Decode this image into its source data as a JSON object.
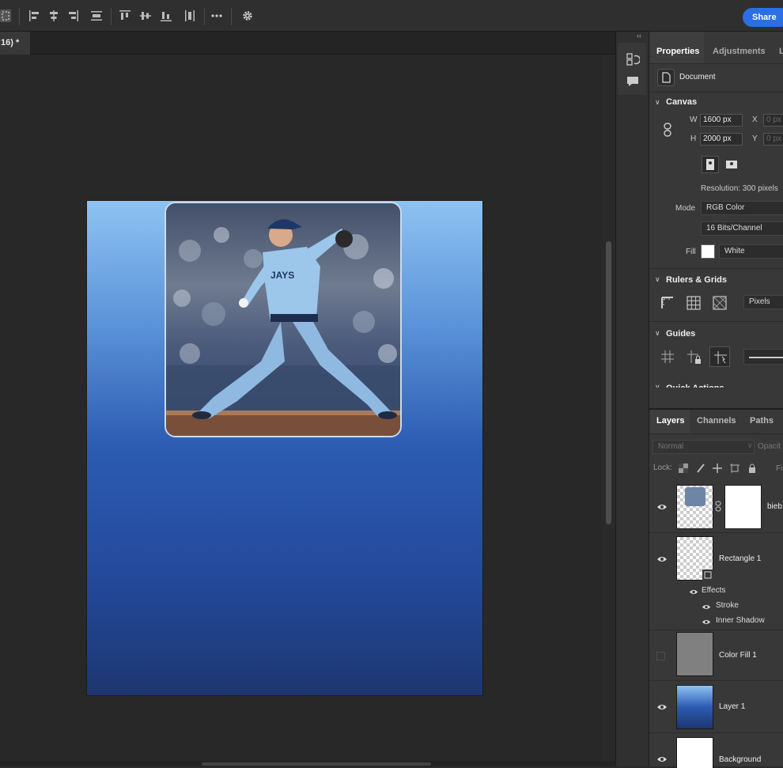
{
  "window": {
    "title_fragment": "..."
  },
  "toolbar": {
    "share_label": "Share"
  },
  "document": {
    "tab_label": "16) *"
  },
  "properties": {
    "tabs": [
      "Properties",
      "Adjustments",
      "L"
    ],
    "document_label": "Document",
    "canvas": {
      "title": "Canvas",
      "w_label": "W",
      "w_value": "1600 px",
      "h_label": "H",
      "h_value": "2000 px",
      "x_label": "X",
      "x_placeholder": "0 px",
      "y_label": "Y",
      "y_placeholder": "0 px",
      "resolution": "Resolution: 300 pixels",
      "mode_label": "Mode",
      "mode_value": "RGB Color",
      "bits_value": "16 Bits/Channel",
      "fill_label": "Fill",
      "fill_value": "White"
    },
    "rulers": {
      "title": "Rulers & Grids",
      "unit": "Pixels"
    },
    "guides": {
      "title": "Guides"
    },
    "quick_actions": {
      "title": "Quick Actions"
    }
  },
  "layers_panel": {
    "tabs": [
      "Layers",
      "Channels",
      "Paths"
    ],
    "blend_mode": "Normal",
    "opacity_label": "Opacit",
    "lock_label": "Lock:",
    "fill_label_frag": "Fi",
    "layers": [
      {
        "name": "bieb",
        "visible": true
      },
      {
        "name": "Rectangle 1",
        "visible": true,
        "effects_label": "Effects",
        "effects": [
          "Stroke",
          "Inner Shadow"
        ]
      },
      {
        "name": "Color Fill 1",
        "visible": false
      },
      {
        "name": "Layer 1",
        "visible": true
      },
      {
        "name": "Background",
        "visible": true
      }
    ]
  },
  "colors": {
    "accent": "#2b6fe3",
    "panel": "#383838",
    "canvas_bg": "#282828"
  }
}
